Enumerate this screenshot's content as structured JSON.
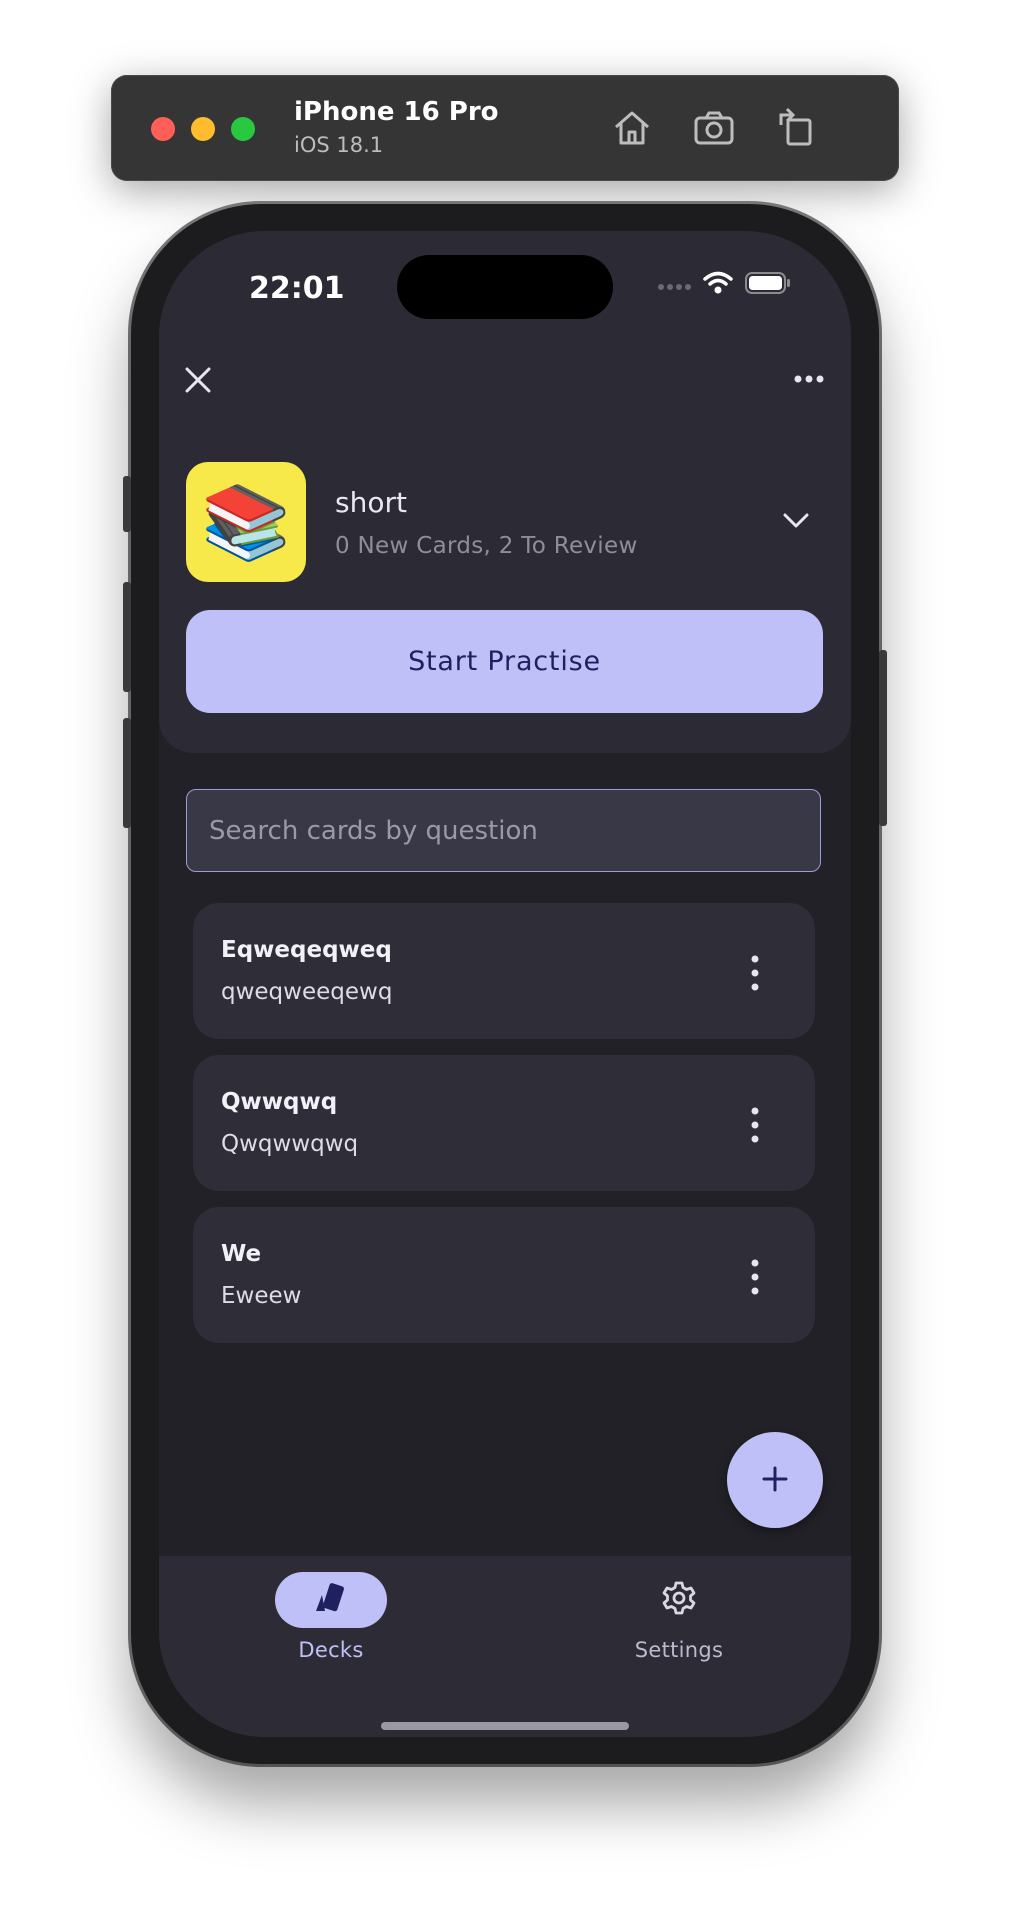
{
  "simulator": {
    "device_name": "iPhone 16 Pro",
    "os_version": "iOS 18.1",
    "icons": [
      "home-icon",
      "screenshot-icon",
      "rotate-icon"
    ]
  },
  "status_bar": {
    "time": "22:01",
    "icons": [
      "signal-icon",
      "wifi-icon",
      "battery-icon"
    ]
  },
  "header": {
    "close_icon": "close-icon",
    "more_icon": "more-horizontal-icon"
  },
  "deck": {
    "emoji": "📚",
    "name": "short",
    "summary": "0 New Cards, 2 To Review",
    "expand_icon": "chevron-down-icon",
    "start_label": "Start Practise"
  },
  "search": {
    "placeholder": "Search cards by question",
    "value": ""
  },
  "cards": [
    {
      "question": "Eqweqeqweq",
      "answer": "qweqweeqewq"
    },
    {
      "question": "Qwwqwq",
      "answer": "Qwqwwqwq"
    },
    {
      "question": "We",
      "answer": "Eweew"
    }
  ],
  "fab": {
    "icon": "plus-icon"
  },
  "bottom_nav": [
    {
      "label": "Decks",
      "icon": "cards-icon",
      "active": true
    },
    {
      "label": "Settings",
      "icon": "gear-icon",
      "active": false
    }
  ],
  "colors": {
    "accent": "#c0c0f8",
    "background": "#222127",
    "surface": "#2c2b35",
    "deck_thumb": "#f8e94a"
  }
}
